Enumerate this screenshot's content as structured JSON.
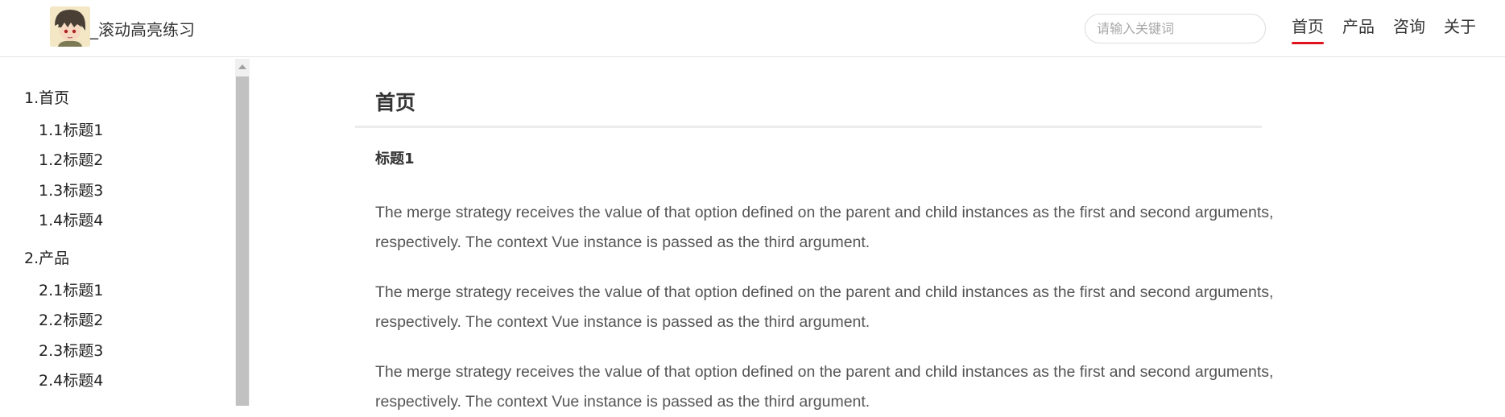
{
  "header": {
    "site_title": "_滚动高亮练习",
    "logo_icon": "anime-avatar-icon",
    "search": {
      "placeholder": "请输入关键词",
      "value": ""
    },
    "nav": [
      {
        "label": "首页",
        "active": true
      },
      {
        "label": "产品",
        "active": false
      },
      {
        "label": "咨询",
        "active": false
      },
      {
        "label": "关于",
        "active": false
      }
    ],
    "active_color": "#e0141e"
  },
  "sidebar": {
    "groups": [
      {
        "label": "1.首页",
        "items": [
          "1.1标题1",
          "1.2标题2",
          "1.3标题3",
          "1.4标题4"
        ]
      },
      {
        "label": "2.产品",
        "items": [
          "2.1标题1",
          "2.2标题2",
          "2.3标题3",
          "2.4标题4"
        ]
      }
    ]
  },
  "main": {
    "section_title": "首页",
    "subsection_title": "标题1",
    "paragraphs": [
      "The merge strategy receives the value of that option defined on the parent and child instances as the first and second arguments, respectively. The context Vue instance is passed as the third argument.",
      "The merge strategy receives the value of that option defined on the parent and child instances as the first and second arguments, respectively. The context Vue instance is passed as the third argument.",
      "The merge strategy receives the value of that option defined on the parent and child instances as the first and second arguments, respectively. The context Vue instance is passed as the third argument."
    ]
  }
}
